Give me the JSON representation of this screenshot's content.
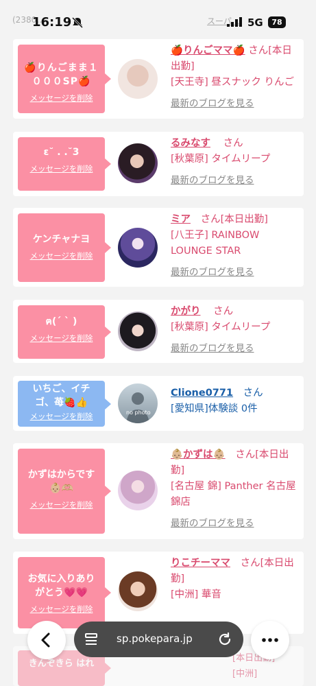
{
  "status": {
    "time": "16:19",
    "network": "5G",
    "battery": "78",
    "bg_left": "(2380…",
    "bg_right": "スーパ…"
  },
  "cards": [
    {
      "msg": "🍎りんごまま１０００SP🍎",
      "delete": "メッセージを削除",
      "name": "🍎りんごママ🍎",
      "san": "さん",
      "status_tag": "[本日出勤]",
      "shop": "[天王寺] 昼スナック りんご",
      "blog": "最新のブログを見る"
    },
    {
      "msg": "ε˘ . .˘3",
      "delete": "メッセージを削除",
      "name": "るみなす",
      "san": "さん",
      "status_tag": "",
      "shop": "[秋葉原] タイムリープ",
      "blog": "最新のブログを見る"
    },
    {
      "msg": "ケンチャナヨ",
      "delete": "メッセージを削除",
      "name": "ミア",
      "san": "さん",
      "status_tag": "[本日出勤]",
      "shop": "[八王子] RAINBOW LOUNGE STAR",
      "blog": "最新のブログを見る"
    },
    {
      "msg": "ฅ(ˊ ˋ )",
      "delete": "メッセージを削除",
      "name": "かがり",
      "san": "さん",
      "status_tag": "",
      "shop": "[秋葉原] タイムリープ",
      "blog": "最新のブログを見る"
    },
    {
      "msg": "いちご、イチゴ、苺🍓👍",
      "delete": "メッセージを削除",
      "name": "Clione0771",
      "san": "さん",
      "status_tag": "",
      "shop": "[愛知県]体験談 0件",
      "blog": "",
      "avatar_text": "no photo"
    },
    {
      "msg": "かずはからです👶🏼🫶🏼",
      "delete": "メッセージを削除",
      "name": "👶🏼かずは👶🏼",
      "san": "さん",
      "status_tag": "[本日出勤]",
      "shop": "[名古屋 錦] Panther 名古屋錦店",
      "blog": "最新のブログを見る"
    },
    {
      "msg": "お気に入りありがとう💗💗",
      "delete": "メッセージを削除",
      "name": "りこチーママ",
      "san": "さん",
      "status_tag": "[本日出勤]",
      "shop": "[中洲] 華音",
      "blog": ""
    }
  ],
  "peek": {
    "msg": "きんぞきら はれ",
    "status_tag": "[本日出勤]",
    "shop": "[中洲]"
  },
  "browser": {
    "url": "sp.pokepara.jp",
    "back_icon": "chevron-left-icon",
    "tabs_icon": "tabs-icon",
    "reload_icon": "reload-icon",
    "more_icon": "more-icon"
  },
  "colors": {
    "pink": "#fb90a4",
    "blue": "#8cb8f2",
    "name_pink": "#d94a6e",
    "name_blue": "#1a5fa8"
  }
}
